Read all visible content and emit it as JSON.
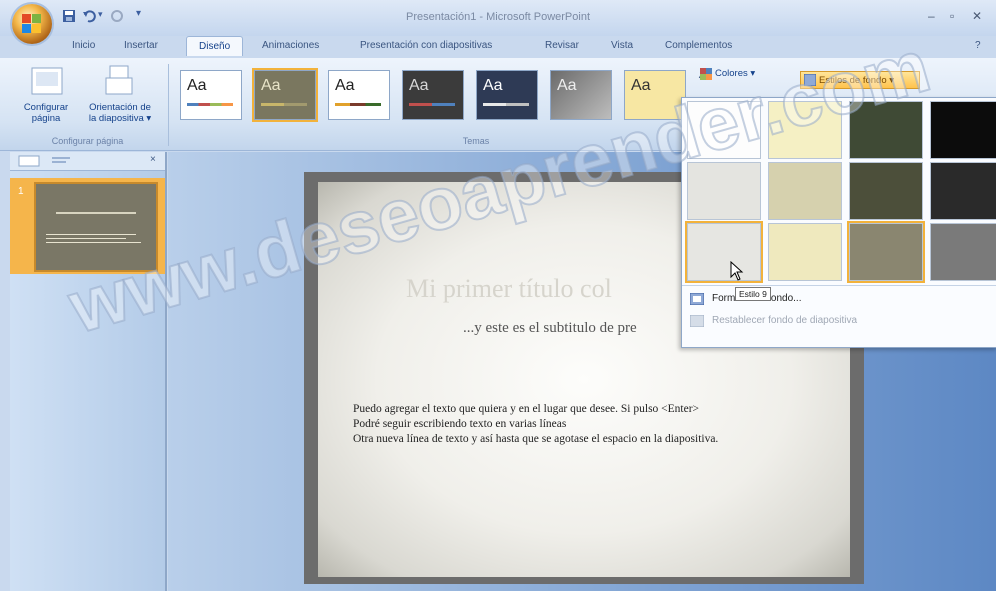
{
  "window": {
    "title": "Presentación1 - Microsoft PowerPoint",
    "controls": [
      "–",
      "▫",
      "✕"
    ]
  },
  "tabs": [
    "Inicio",
    "Insertar",
    "Diseño",
    "Animaciones",
    "Presentación con diapositivas",
    "Revisar",
    "Vista",
    "Complementos"
  ],
  "active_tab": "Diseño",
  "ribbon": {
    "configurar_pagina": "Configurar\npágina",
    "orientacion": "Orientación de\nla diapositiva ▾",
    "group_config": "Configurar página",
    "group_temas": "Temas",
    "colores": "Colores ▾",
    "estilos_fondo": "Estilos de fondo ▾",
    "theme_aa": "Aa"
  },
  "slide_panel": {
    "slide_number": "1"
  },
  "slide": {
    "title": "Mi primer título col",
    "subtitle": "...y este es el subtitulo de pre",
    "body_lines": [
      "Puedo agregar el texto que quiera y en el lugar que desee. Si pulso <Enter>",
      "Podré  seguir escribiendo texto en varias líneas",
      "Otra nueva línea de texto y así hasta que se agotase el espacio en la diapositiva."
    ]
  },
  "gallery": {
    "tooltip": "Estilo 9",
    "format_item": "Formato del fondo...",
    "reset_item": "Restablecer fondo de diapositiva"
  },
  "watermark": "www.deseoaprender.com",
  "colors": {
    "accent": "#f2b23b",
    "ribbon_text": "#15428b"
  }
}
